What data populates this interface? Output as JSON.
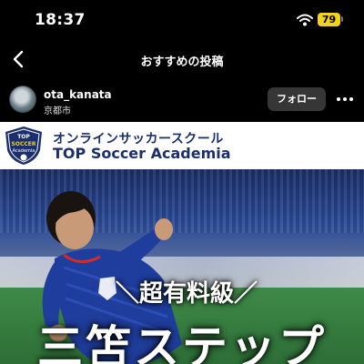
{
  "status_bar": {
    "time": "18:37",
    "battery": "79",
    "wifi_icon": "wifi-icon"
  },
  "header": {
    "title": "おすすめの投稿",
    "back_icon": "chevron-left-icon"
  },
  "post": {
    "username": "ota_kanata",
    "location": "京都市",
    "follow_label": "フォロー",
    "more_icon": "ellipsis-icon"
  },
  "image": {
    "badge_line1": "TOP",
    "badge_line2": "SOCCER",
    "badge_line3": "Academia",
    "school_jp": "オンラインサッカースクール",
    "school_en": "TOP Soccer Academia",
    "headline_small": "＼超有料級／",
    "headline_big": "三笘ステップ"
  },
  "colors": {
    "brand_navy": "#1b2f6e",
    "battery_yellow": "#f2d21c",
    "follow_bg": "#363636"
  }
}
